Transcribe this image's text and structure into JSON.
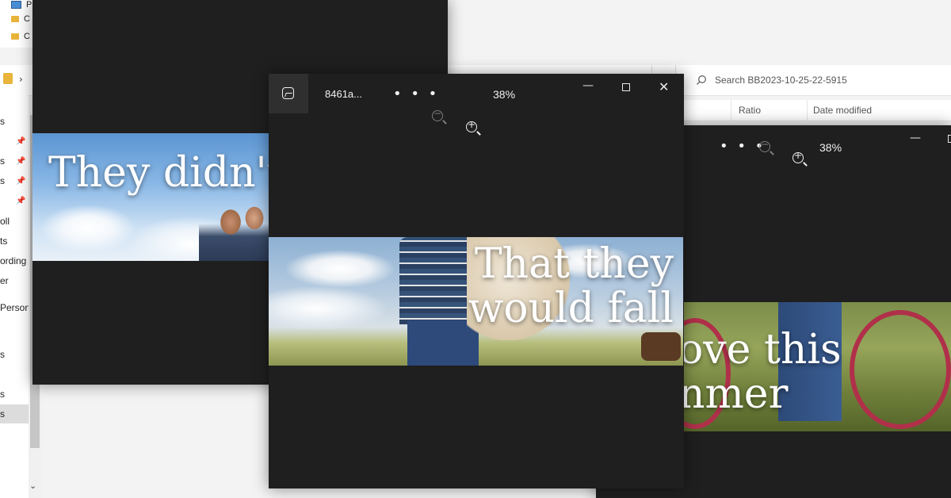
{
  "explorer": {
    "top_items": [
      "P",
      "C",
      "C"
    ],
    "search_placeholder": "Search BB2023-10-25-22-5915",
    "columns": {
      "ratio": "Ratio",
      "date_modified": "Date modified"
    },
    "nav_items": [
      "s",
      "s",
      "s",
      "ts",
      "",
      "oll",
      "ts",
      "ording",
      "er",
      "Person",
      "s",
      "s",
      "s"
    ]
  },
  "photos_back": {
    "image_text": "They didn't k"
  },
  "photos_front": {
    "filename": "8461a...",
    "more_label": "• • •",
    "zoom": "38%",
    "image_text_line1": "That they",
    "image_text_line2": "would fall"
  },
  "photos_right": {
    "more_label": "• • •",
    "zoom": "38%",
    "image_text_line1": "ove this",
    "image_text_line2": "nmer"
  },
  "colors": {
    "photos_bg": "#1f1f1f",
    "explorer_bg": "#f3f3f3",
    "text_light": "#f0f0f0"
  },
  "icons": [
    "image-icon",
    "zoom-out-icon",
    "zoom-in-icon",
    "minimize-icon",
    "maximize-icon",
    "close-icon",
    "search-icon",
    "pin-icon",
    "folder-icon",
    "chevron-right-icon",
    "chevron-down-icon"
  ]
}
